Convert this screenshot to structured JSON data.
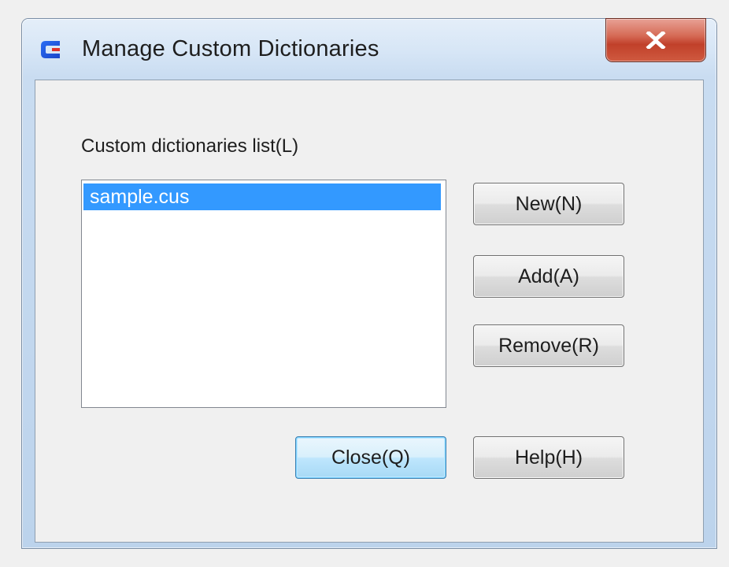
{
  "window": {
    "title": "Manage Custom Dictionaries",
    "icon": "app-logo-icon",
    "close_glyph": "X"
  },
  "dictionaries": {
    "label": "Custom dictionaries list(L)",
    "items": [
      "sample.cus"
    ],
    "selected_index": 0
  },
  "buttons": {
    "new_label": "New(N)",
    "add_label": "Add(A)",
    "remove_label": "Remove(R)",
    "close_label": "Close(Q)",
    "help_label": "Help(H)"
  },
  "colors": {
    "selection": "#3399ff",
    "close_button": "#c1402a",
    "frame": "#c9dcf1"
  }
}
